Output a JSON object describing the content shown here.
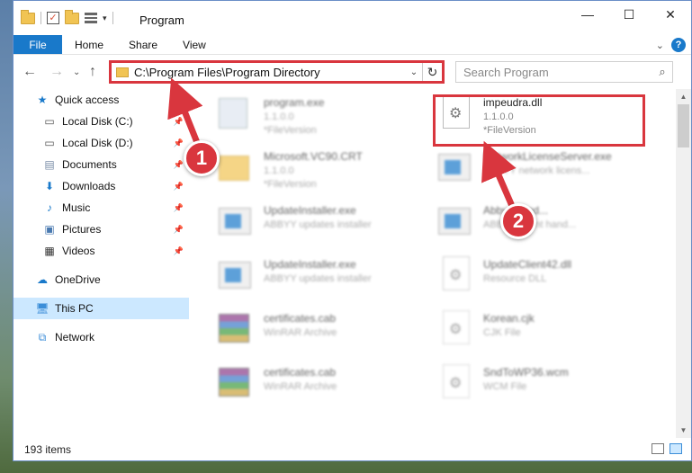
{
  "window": {
    "title": "Program",
    "controls": {
      "minimize": "—",
      "maximize": "☐",
      "close": "✕"
    }
  },
  "ribbon": {
    "tabs": [
      "File",
      "Home",
      "Share",
      "View"
    ]
  },
  "address": {
    "path": "C:\\Program Files\\Program Directory"
  },
  "search": {
    "placeholder": "Search Program"
  },
  "sidebar": {
    "items": [
      {
        "label": "Quick access",
        "icon": "star-icon",
        "pinned": false
      },
      {
        "label": "Local Disk (C:)",
        "icon": "drive-icon",
        "pinned": true
      },
      {
        "label": "Local Disk (D:)",
        "icon": "drive-icon",
        "pinned": true
      },
      {
        "label": "Documents",
        "icon": "documents-icon",
        "pinned": true
      },
      {
        "label": "Downloads",
        "icon": "download-icon",
        "pinned": true
      },
      {
        "label": "Music",
        "icon": "music-icon",
        "pinned": true
      },
      {
        "label": "Pictures",
        "icon": "pictures-icon",
        "pinned": true
      },
      {
        "label": "Videos",
        "icon": "video-icon",
        "pinned": true
      },
      {
        "label": "OneDrive",
        "icon": "cloud-icon",
        "pinned": false
      },
      {
        "label": "This PC",
        "icon": "computer-icon",
        "pinned": false,
        "selected": true
      },
      {
        "label": "Network",
        "icon": "network-icon",
        "pinned": false
      }
    ]
  },
  "files": [
    {
      "name": "program.exe",
      "sub1": "1.1.0.0",
      "sub2": "*FileVersion",
      "icon": "exe-icon",
      "blurred": true
    },
    {
      "name": "impeudra.dll",
      "sub1": "1.1.0.0",
      "sub2": "*FileVersion",
      "icon": "dll-icon",
      "blurred": false,
      "highlighted": true
    },
    {
      "name": "Microsoft.VC90.CRT",
      "sub1": "1.1.0.0",
      "sub2": "*FileVersion",
      "icon": "folder-icon",
      "blurred": true
    },
    {
      "name": "NetworkLicenseServer.exe",
      "sub1": "ABBYY network licens...",
      "sub2": "",
      "icon": "installer-icon",
      "blurred": true
    },
    {
      "name": "UpdateInstaller.exe",
      "sub1": "ABBYY updates installer",
      "sub2": "",
      "icon": "installer-icon",
      "blurred": true
    },
    {
      "name": "AbbyyHand...",
      "sub1": "ABBYY event hand...",
      "sub2": "",
      "icon": "installer-icon",
      "blurred": true
    },
    {
      "name": "UpdateInstaller.exe",
      "sub1": "ABBYY updates installer",
      "sub2": "",
      "icon": "installer-icon",
      "blurred": true
    },
    {
      "name": "UpdateClient42.dll",
      "sub1": "Resource DLL",
      "sub2": "",
      "icon": "dll-icon",
      "blurred": true
    },
    {
      "name": "certificates.cab",
      "sub1": "WinRAR Archive",
      "sub2": "",
      "icon": "archive-icon",
      "blurred": true
    },
    {
      "name": "Korean.cjk",
      "sub1": "CJK File",
      "sub2": "",
      "icon": "file-icon",
      "blurred": true
    },
    {
      "name": "certificates.cab",
      "sub1": "WinRAR Archive",
      "sub2": "",
      "icon": "archive-icon",
      "blurred": true
    },
    {
      "name": "SndToWP36.wcm",
      "sub1": "WCM File",
      "sub2": "",
      "icon": "file-icon",
      "blurred": true
    }
  ],
  "status": {
    "count": "193 items"
  },
  "annotations": {
    "callout1": "1",
    "callout2": "2",
    "color": "#d9363e"
  }
}
